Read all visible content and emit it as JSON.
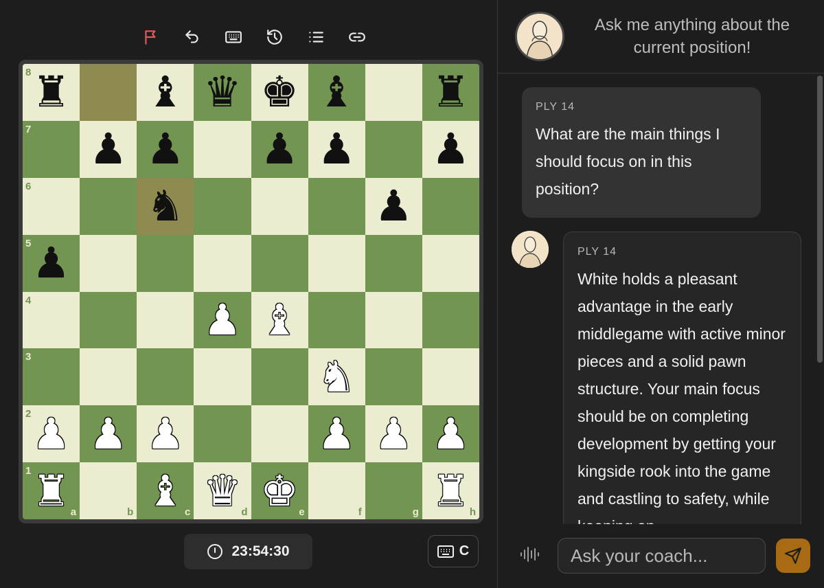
{
  "toolbar": {
    "items": [
      {
        "name": "flag-icon",
        "color": "#e05a5a"
      },
      {
        "name": "undo-icon"
      },
      {
        "name": "keyboard-icon"
      },
      {
        "name": "history-icon"
      },
      {
        "name": "list-icon"
      },
      {
        "name": "link-icon"
      }
    ]
  },
  "board": {
    "light_color": "#ebecd0",
    "dark_color": "#739552",
    "highlight_color": "#8f8a50",
    "ranks": [
      "8",
      "7",
      "6",
      "5",
      "4",
      "3",
      "2",
      "1"
    ],
    "files": [
      "a",
      "b",
      "c",
      "d",
      "e",
      "f",
      "g",
      "h"
    ],
    "highlighted": [
      "b8",
      "c6"
    ],
    "pieces": {
      "a8": "bR",
      "c8": "bB",
      "d8": "bQ",
      "e8": "bK",
      "f8": "bB",
      "h8": "bR",
      "b7": "bP",
      "c7": "bP",
      "e7": "bP",
      "f7": "bP",
      "h7": "bP",
      "c6": "bN",
      "g6": "bP",
      "a5": "bP",
      "d4": "wP",
      "e4": "wB",
      "f3": "wN",
      "a2": "wP",
      "b2": "wP",
      "c2": "wP",
      "f2": "wP",
      "g2": "wP",
      "h2": "wP",
      "a1": "wR",
      "c1": "wB",
      "d1": "wQ",
      "e1": "wK",
      "h1": "wR"
    }
  },
  "timer": {
    "value": "23:54:30",
    "icon": "clock-icon"
  },
  "keyboard_button": {
    "label": "C",
    "icon": "keyboard-icon"
  },
  "coach": {
    "header_text": "Ask me anything about the current position!",
    "messages": [
      {
        "role": "user",
        "ply": "PLY 14",
        "text": "What are the main things I should focus on in this position?"
      },
      {
        "role": "coach",
        "ply": "PLY 14",
        "text": "White holds a pleasant advantage in the early middlegame with active minor pieces and a solid pawn structure. Your main focus should be on completing development by getting your kingside rook into the game and castling to safety, while keeping an"
      }
    ]
  },
  "input": {
    "placeholder": "Ask your coach..."
  },
  "accent": "#a86a12"
}
